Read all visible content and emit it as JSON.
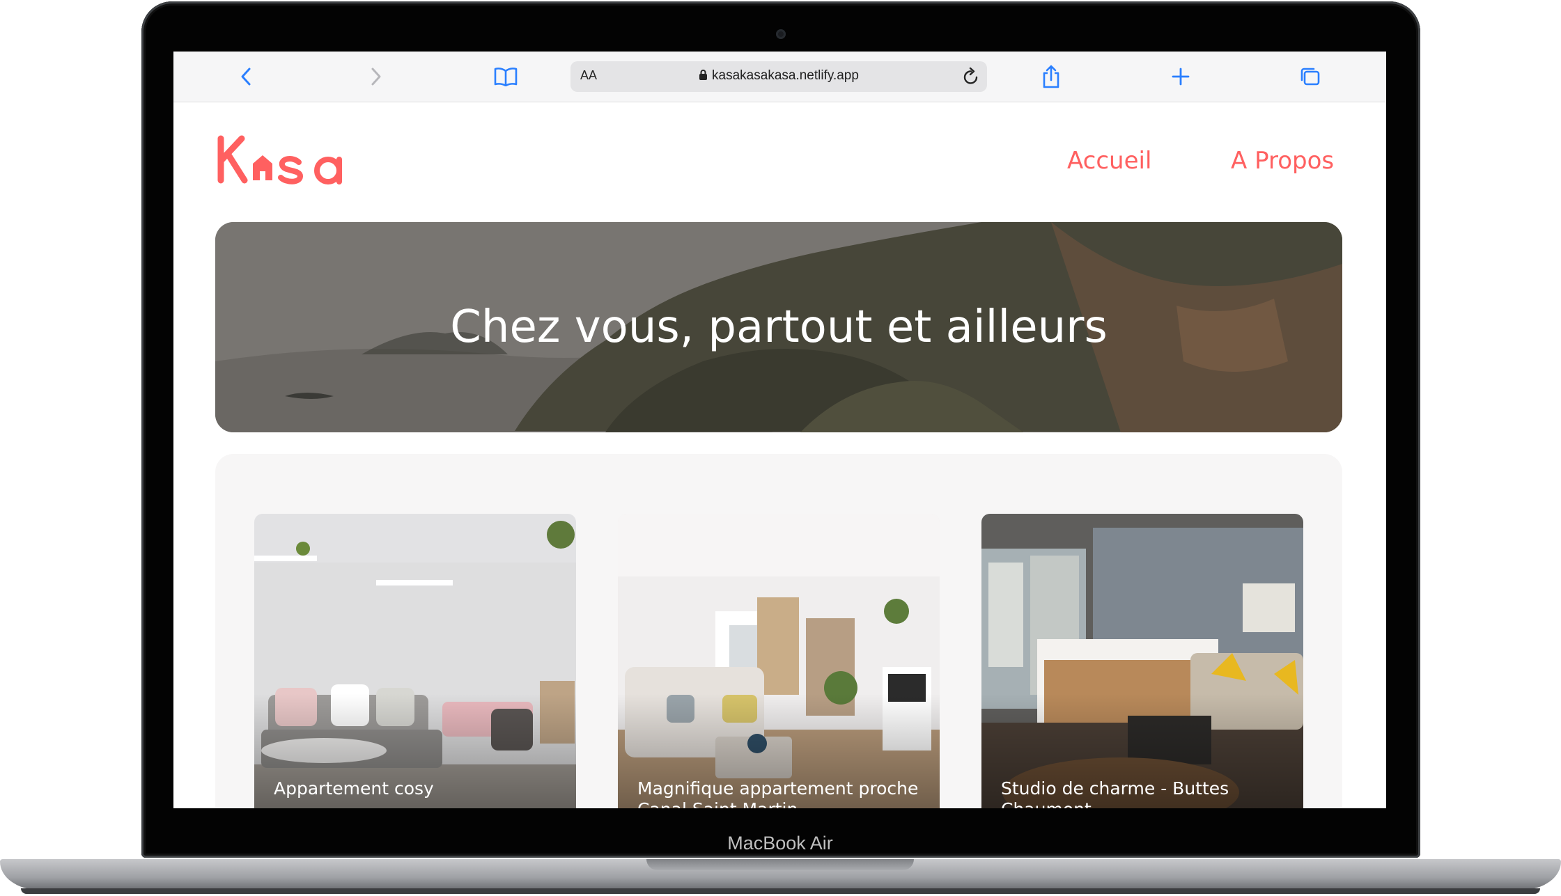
{
  "device": {
    "label": "MacBook Air"
  },
  "browser": {
    "text_size_button": "AA",
    "url": "kasakasakasa.netlify.app"
  },
  "header": {
    "logo": "Kasa",
    "nav": [
      {
        "label": "Accueil"
      },
      {
        "label": "A Propos"
      }
    ]
  },
  "hero": {
    "title": "Chez vous, partout et ailleurs"
  },
  "listings": [
    {
      "title": "Appartement cosy"
    },
    {
      "title": "Magnifique appartement proche Canal Saint Martin"
    },
    {
      "title": "Studio de charme - Buttes Chaumont"
    }
  ],
  "colors": {
    "brand": "#ff6060",
    "gallery_bg": "#f7f6f6"
  }
}
